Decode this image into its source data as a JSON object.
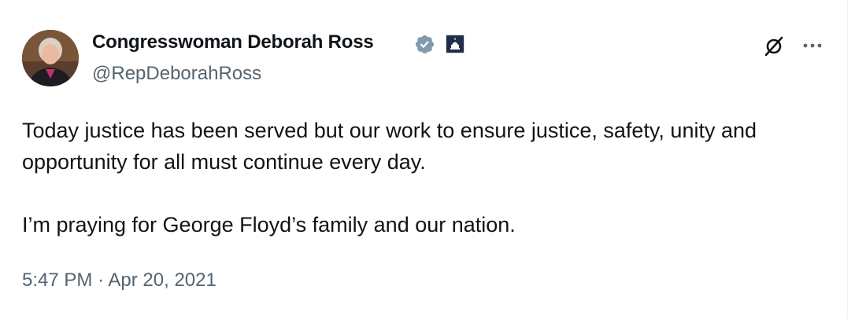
{
  "author": {
    "name": "Congresswoman Deborah Ross",
    "handle": "@RepDeborahRoss"
  },
  "icons": {
    "avatar": "profile-photo",
    "verified": "verified-badge-icon",
    "affiliation": "capitol-building-icon",
    "grok": "grok-icon",
    "more": "more-options-icon"
  },
  "tweet": {
    "paragraphs": [
      "Today justice has been served but our work to ensure justice, safety, unity and opportunity for all must continue every day.",
      "I’m praying for George Floyd’s family and our nation."
    ],
    "time": "5:47 PM",
    "separator": "·",
    "date": "Apr 20, 2021"
  },
  "colors": {
    "text": "#0f1419",
    "secondary": "#536471",
    "verified_gray": "#829aab",
    "badge_navy": "#1f2f4a",
    "divider": "#eff3f4"
  }
}
